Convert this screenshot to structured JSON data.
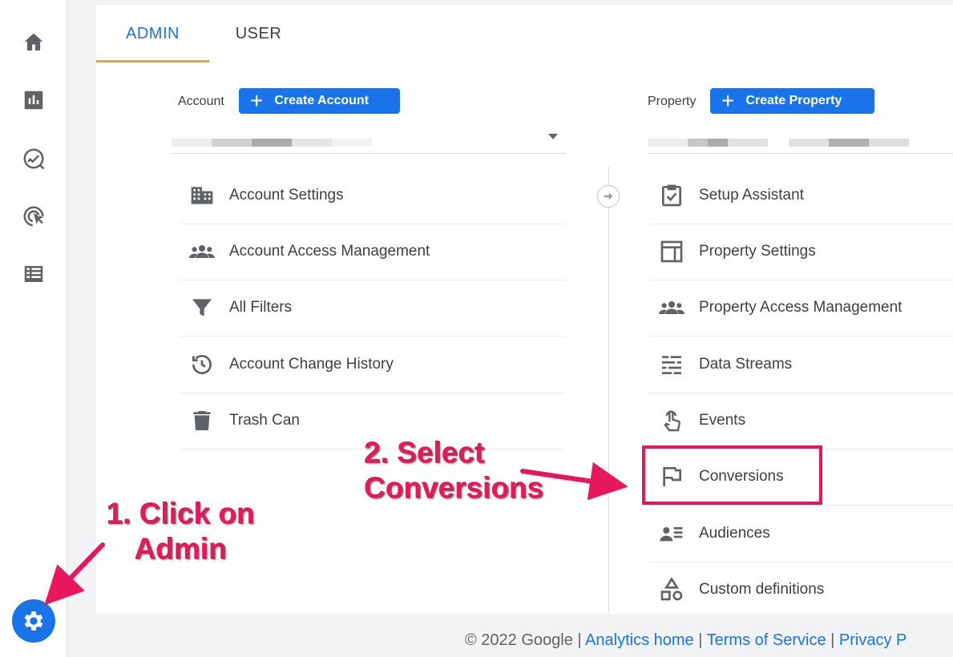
{
  "tabs": [
    {
      "label": "ADMIN",
      "active": true
    },
    {
      "label": "USER",
      "active": false
    }
  ],
  "rail": {
    "items": [
      "home-icon",
      "reports-icon",
      "explore-icon",
      "advertising-icon",
      "configure-icon"
    ],
    "settings_icon": "gear-icon"
  },
  "account": {
    "label": "Account",
    "create_button": "Create Account",
    "menu": [
      {
        "icon": "building-icon",
        "label": "Account Settings"
      },
      {
        "icon": "people-icon",
        "label": "Account Access Management"
      },
      {
        "icon": "filter-icon",
        "label": "All Filters"
      },
      {
        "icon": "history-icon",
        "label": "Account Change History"
      },
      {
        "icon": "trash-icon",
        "label": "Trash Can"
      }
    ]
  },
  "property": {
    "label": "Property",
    "create_button": "Create Property",
    "menu": [
      {
        "icon": "checklist-icon",
        "label": "Setup Assistant"
      },
      {
        "icon": "layout-icon",
        "label": "Property Settings"
      },
      {
        "icon": "people-icon",
        "label": "Property Access Management"
      },
      {
        "icon": "streams-icon",
        "label": "Data Streams"
      },
      {
        "icon": "touch-icon",
        "label": "Events"
      },
      {
        "icon": "flag-icon",
        "label": "Conversions"
      },
      {
        "icon": "audience-icon",
        "label": "Audiences"
      },
      {
        "icon": "shapes-icon",
        "label": "Custom definitions"
      }
    ]
  },
  "footer": {
    "copyright": "© 2022 Google |",
    "links": [
      "Analytics home",
      "Terms of Service",
      "Privacy P"
    ],
    "sep": "|"
  },
  "annotations": {
    "step1_line1": "1. Click on",
    "step1_line2": "Admin",
    "step2_line1": "2. Select",
    "step2_line2": "Conversions"
  },
  "colors": {
    "primary": "#1a73e8",
    "tab_indicator": "#e8a02e",
    "annotation": "#e8175d"
  }
}
